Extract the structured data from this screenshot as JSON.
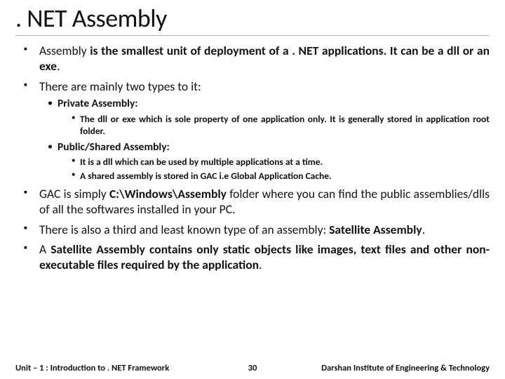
{
  "title": ". NET Assembly",
  "bullets": {
    "b1_pre": "Assembly ",
    "b1_bold": "is the smallest unit of deployment of a . NET applications. It can be a dll or an exe",
    "b1_post": ".",
    "b2": "There are mainly two types to it:",
    "sub1_label": "Private Assembly:",
    "sub1_detail": "The dll or exe which is sole property of one application only. It is generally stored in application root folder.",
    "sub2_label": "Public/Shared Assembly:",
    "sub2_detail1": "It is a dll which can be used by multiple applications at a time.",
    "sub2_detail2": "A shared assembly is stored in GAC i.e Global Application Cache.",
    "b3_pre": "GAC is simply ",
    "b3_bold": "C:\\Windows\\Assembly",
    "b3_post": " folder where you can find the public assemblies/dlls of all the softwares installed in your PC.",
    "b4_pre": "There is also a third and least known type of an assembly: ",
    "b4_bold": "Satellite Assembly",
    "b4_post": ".",
    "b5_pre": "A ",
    "b5_bold": "Satellite Assembly contains only static objects like images, text files and other non-executable files required by the application",
    "b5_post": "."
  },
  "footer": {
    "left": "Unit – 1 : Introduction to . NET Framework",
    "page": "30",
    "right": "Darshan Institute of Engineering & Technology"
  }
}
